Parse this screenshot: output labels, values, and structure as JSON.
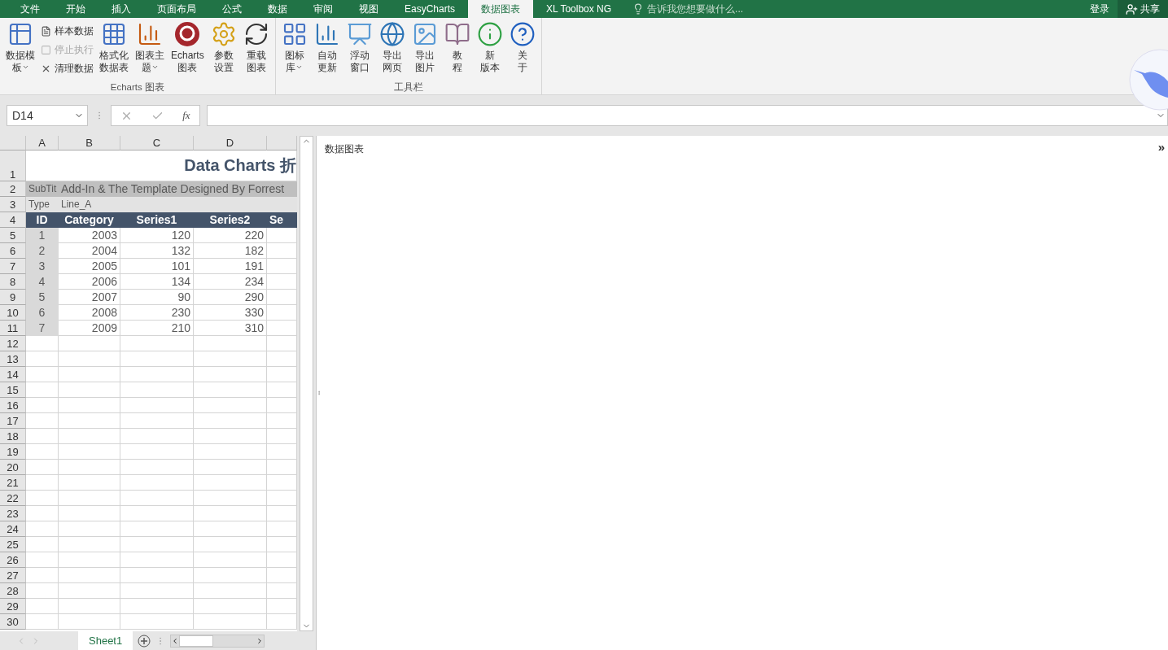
{
  "menu_tabs": [
    {
      "label": "文件",
      "selected": false
    },
    {
      "label": "开始",
      "selected": false
    },
    {
      "label": "插入",
      "selected": false
    },
    {
      "label": "页面布局",
      "selected": false
    },
    {
      "label": "公式",
      "selected": false
    },
    {
      "label": "数据",
      "selected": false
    },
    {
      "label": "审阅",
      "selected": false
    },
    {
      "label": "视图",
      "selected": false
    },
    {
      "label": "EasyCharts",
      "selected": false
    },
    {
      "label": "数据图表",
      "selected": true
    },
    {
      "label": "XL Toolbox NG",
      "selected": false
    }
  ],
  "tell_me": {
    "placeholder": "告诉我您想要做什么..."
  },
  "account": {
    "sign_in": "登录",
    "share": "共享"
  },
  "ribbon_groups": [
    {
      "label": "Echarts 图表",
      "items": [
        {
          "kind": "large",
          "lines": [
            "数据模",
            "板"
          ],
          "dropdown": true
        },
        {
          "kind": "stack",
          "items": [
            {
              "label": "样本数据",
              "disabled": false
            },
            {
              "label": "停止执行",
              "disabled": true
            },
            {
              "label": "清理数据",
              "disabled": false
            }
          ]
        },
        {
          "kind": "large",
          "lines": [
            "格式化",
            "数据表"
          ],
          "dropdown": false
        },
        {
          "kind": "large",
          "lines": [
            "图表主",
            "题"
          ],
          "dropdown": true
        },
        {
          "kind": "large",
          "lines": [
            "Echarts",
            "图表"
          ],
          "dropdown": false
        },
        {
          "kind": "large",
          "lines": [
            "参数",
            "设置"
          ],
          "dropdown": false
        },
        {
          "kind": "large",
          "lines": [
            "重载",
            "图表"
          ],
          "dropdown": false
        }
      ]
    },
    {
      "label": "工具栏",
      "items": [
        {
          "kind": "large",
          "lines": [
            "图标",
            "库"
          ],
          "dropdown": true
        },
        {
          "kind": "large",
          "lines": [
            "自动",
            "更新"
          ],
          "dropdown": false
        },
        {
          "kind": "large",
          "lines": [
            "浮动",
            "窗口"
          ],
          "dropdown": false
        },
        {
          "kind": "large",
          "lines": [
            "导出",
            "网页"
          ],
          "dropdown": false
        },
        {
          "kind": "large",
          "lines": [
            "导出",
            "图片"
          ],
          "dropdown": false
        },
        {
          "kind": "large",
          "lines": [
            "教",
            "程"
          ],
          "dropdown": false
        },
        {
          "kind": "large",
          "lines": [
            "新",
            "版本"
          ],
          "dropdown": false
        },
        {
          "kind": "large",
          "lines": [
            "关",
            "于"
          ],
          "dropdown": false
        }
      ]
    }
  ],
  "formula_bar": {
    "name_box": "D14",
    "function_label": "fx"
  },
  "sheet": {
    "columns": [
      "A",
      "B",
      "C",
      "D"
    ],
    "rows": [
      {
        "number": "1",
        "kind": "title",
        "cells": [
          "Data Charts 折"
        ]
      },
      {
        "number": "2",
        "kind": "subtitle",
        "cells": [
          "SubTit",
          "Add-In & The Template Designed By Forrest"
        ]
      },
      {
        "number": "3",
        "kind": "type",
        "cells": [
          "Type",
          "Line_A"
        ]
      },
      {
        "number": "4",
        "kind": "header",
        "cells": [
          "ID",
          "Category",
          "Series1",
          "Series2",
          "Se"
        ]
      },
      {
        "number": "5",
        "kind": "data",
        "cells": [
          "1",
          "2003",
          "120",
          "220"
        ]
      },
      {
        "number": "6",
        "kind": "data",
        "cells": [
          "2",
          "2004",
          "132",
          "182"
        ]
      },
      {
        "number": "7",
        "kind": "data",
        "cells": [
          "3",
          "2005",
          "101",
          "191"
        ]
      },
      {
        "number": "8",
        "kind": "data",
        "cells": [
          "4",
          "2006",
          "134",
          "234"
        ]
      },
      {
        "number": "9",
        "kind": "data",
        "cells": [
          "5",
          "2007",
          "90",
          "290"
        ]
      },
      {
        "number": "10",
        "kind": "data",
        "cells": [
          "6",
          "2008",
          "230",
          "330"
        ]
      },
      {
        "number": "11",
        "kind": "data",
        "cells": [
          "7",
          "2009",
          "210",
          "310"
        ]
      },
      {
        "number": "12",
        "kind": "empty"
      },
      {
        "number": "13",
        "kind": "empty"
      },
      {
        "number": "14",
        "kind": "empty"
      },
      {
        "number": "15",
        "kind": "empty"
      },
      {
        "number": "16",
        "kind": "empty"
      },
      {
        "number": "17",
        "kind": "empty"
      },
      {
        "number": "18",
        "kind": "empty"
      },
      {
        "number": "19",
        "kind": "empty"
      },
      {
        "number": "20",
        "kind": "empty"
      },
      {
        "number": "21",
        "kind": "empty"
      },
      {
        "number": "22",
        "kind": "empty"
      },
      {
        "number": "23",
        "kind": "empty"
      },
      {
        "number": "24",
        "kind": "empty"
      },
      {
        "number": "25",
        "kind": "empty"
      },
      {
        "number": "26",
        "kind": "empty"
      },
      {
        "number": "27",
        "kind": "empty"
      },
      {
        "number": "28",
        "kind": "empty"
      },
      {
        "number": "29",
        "kind": "empty"
      },
      {
        "number": "30",
        "kind": "empty"
      }
    ]
  },
  "sheet_tabs": [
    {
      "label": "Sheet1",
      "selected": true
    }
  ],
  "task_pane": {
    "title": "数据图表",
    "collapse": "»"
  }
}
